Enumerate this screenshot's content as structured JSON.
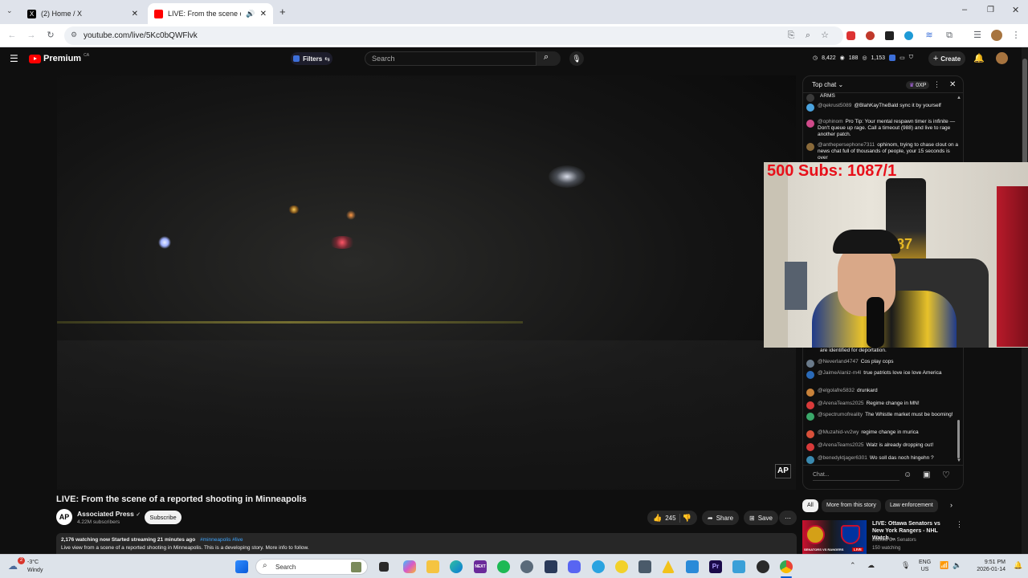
{
  "browser": {
    "tabs": [
      {
        "label": "(2) Home / X"
      },
      {
        "label": "LIVE: From the scene of a re"
      }
    ],
    "url": "youtube.com/live/5Kc0bQWFlvk"
  },
  "yt_header": {
    "brand": "Premium",
    "country": "CA",
    "filters_label": "Filters",
    "search_placeholder": "Search",
    "stat1": "8,422",
    "stat2": "188",
    "stat3": "1,153",
    "create_label": "Create"
  },
  "chat": {
    "header": "Top chat",
    "points": "0XP",
    "input_placeholder": "Chat...",
    "top_messages": [
      {
        "author": "",
        "text": "ARMS",
        "color": "#3a3a3a"
      },
      {
        "author": "@qekrust5089",
        "text": "@BlahKayTheBald sync it by yourself",
        "color": "#4aa3df"
      },
      {
        "author": "@ophinom",
        "text": "Pro Tip: Your mental respawn timer is infinite — Don't queue up rage. Call a timeout (988) and live to rage another patch.",
        "color": "#d04a8a"
      },
      {
        "author": "@anthepersephone7311",
        "text": "ophinom, trying to chase clout on a news chat full of thousands of people, your 15 seconds is over",
        "color": "#8a6a3a"
      }
    ],
    "bottom_messages": [
      {
        "author": "",
        "text": "are identified for deportation.",
        "color": "#0f0f0f"
      },
      {
        "author": "@Neverland4747",
        "text": "Cos play cops",
        "color": "#6a7a8a"
      },
      {
        "author": "@JaimeAlaniz-m4l",
        "text": "true patriots love ice love America",
        "color": "#2a6ab8"
      },
      {
        "author": "@elgolafre5832",
        "text": "drunkard",
        "color": "#c8823a"
      },
      {
        "author": "@ArenaTeams2025",
        "text": "Regime change in MN!",
        "color": "#d83a3a"
      },
      {
        "author": "@spectrumofreality",
        "text": "The Whistle market must be booming!",
        "color": "#3aa86a"
      },
      {
        "author": "@Muzahid-vv2wy",
        "text": "regime change in murica",
        "color": "#d8503a"
      },
      {
        "author": "@ArenaTeams2025",
        "text": "Walz is already dropping out!",
        "color": "#d83a3a"
      },
      {
        "author": "@benedyktjager6301",
        "text": "Wo soll das noch hingehn ?",
        "color": "#3a8ab0"
      }
    ]
  },
  "overlay": {
    "subs_text": "500  Subs: 1087/1"
  },
  "video": {
    "title": "LIVE: From the scene of a reported shooting in Minneapolis",
    "channel": "Associated Press",
    "subscribers": "4.22M subscribers",
    "subscribe_label": "Subscribe",
    "likes": "245",
    "share_label": "Share",
    "save_label": "Save",
    "watching": "2,176 watching now  Started streaming 21 minutes ago",
    "hashtags": "#minneapolis #live",
    "description": "Live view from a scene of a reported shooting in Minneapolis. This is a developing story. More info to follow.",
    "watermark": "AP"
  },
  "chips": [
    "All",
    "More from this story",
    "Law enforcement"
  ],
  "recommendation": {
    "title": "LIVE: Ottawa Senators vs New York Rangers - NHL Watch ...",
    "channel": "Locked On Senators",
    "watching": "150 watching",
    "badge": "LIVE",
    "thumb_text": "SENATORS VS RANGERS"
  },
  "taskbar": {
    "weather_temp": "-3°C",
    "weather_desc": "Windy",
    "weather_badge": "2",
    "search_label": "Search",
    "lang": "ENG",
    "region": "US",
    "time": "9:51 PM",
    "date": "2026-01-14"
  }
}
